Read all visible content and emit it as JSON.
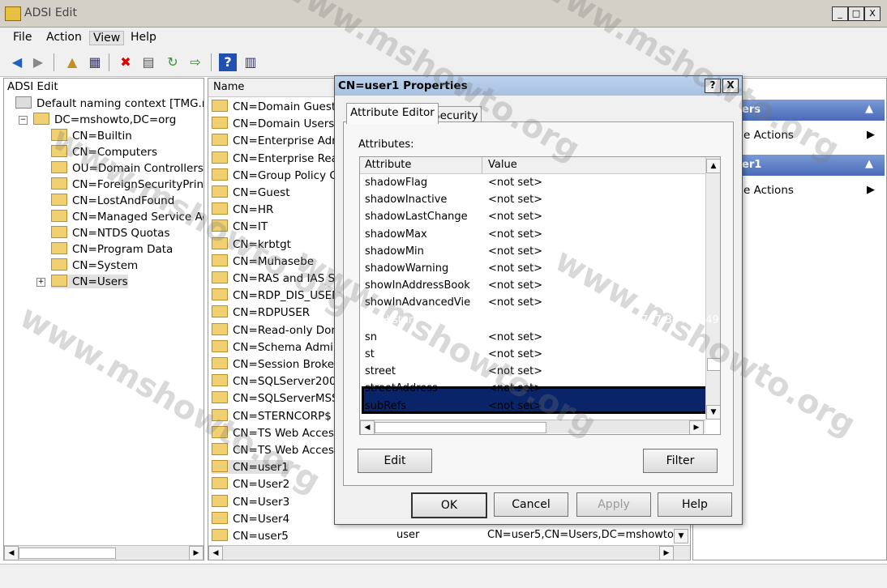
{
  "window": {
    "title": "ADSI Edit",
    "min": "_",
    "max": "□",
    "close": "X"
  },
  "menu": [
    "File",
    "Action",
    "View",
    "Help"
  ],
  "tree": {
    "root": "ADSI Edit",
    "context": "Default naming context [TMG.msh",
    "domain": "DC=mshowto,DC=org",
    "children": [
      "CN=Builtin",
      "CN=Computers",
      "OU=Domain Controllers",
      "CN=ForeignSecurityPrincip",
      "CN=LostAndFound",
      "CN=Managed Service Acco",
      "CN=NTDS Quotas",
      "CN=Program Data",
      "CN=System",
      "CN=Users"
    ]
  },
  "list": {
    "col_name": "Name",
    "rows": [
      "CN=Domain Guests",
      "CN=Domain Users",
      "CN=Enterprise Admin",
      "CN=Enterprise Read-",
      "CN=Group Policy Cre",
      "CN=Guest",
      "CN=HR",
      "CN=IT",
      "CN=krbtgt",
      "CN=Muhasebe",
      "CN=RAS and IAS Ser",
      "CN=RDP_DIS_USERS",
      "CN=RDPUSER",
      "CN=Read-only Doma",
      "CN=Schema Admins",
      "CN=Session Broker C",
      "CN=SQLServer2005S",
      "CN=SQLServerMSSQ",
      "CN=STERNCORP$",
      "CN=TS Web Access A",
      "CN=TS Web Access C",
      "CN=user1",
      "CN=User2",
      "CN=User3",
      "CN=User4",
      "CN=user5"
    ],
    "last_class": "user",
    "last_dn": "CN=user5,CN=Users,DC=mshowto,D"
  },
  "actions": {
    "section1": "ers",
    "item1": "e Actions",
    "section2": "er1",
    "item2": "e Actions"
  },
  "dialog": {
    "title": "CN=user1 Properties",
    "help": "?",
    "close": "X",
    "tabs": [
      "Attribute Editor",
      "Security"
    ],
    "attributes_label": "Attributes:",
    "col_attr": "Attribute",
    "col_value": "Value",
    "rows": [
      {
        "attr": "shadowFlag",
        "value": "<not set>"
      },
      {
        "attr": "shadowInactive",
        "value": "<not set>"
      },
      {
        "attr": "shadowLastChange",
        "value": "<not set>"
      },
      {
        "attr": "shadowMax",
        "value": "<not set>"
      },
      {
        "attr": "shadowMin",
        "value": "<not set>"
      },
      {
        "attr": "shadowWarning",
        "value": "<not set>"
      },
      {
        "attr": "showInAddressBook",
        "value": "<not set>"
      },
      {
        "attr": "showInAdvancedVie",
        "value": "<not set>"
      },
      {
        "attr": "sIDHistory",
        "value": "S-1-5-21-3479589468-138638767-38420749"
      },
      {
        "attr": "sn",
        "value": "<not set>"
      },
      {
        "attr": "st",
        "value": "<not set>"
      },
      {
        "attr": "street",
        "value": "<not set>"
      },
      {
        "attr": "streetAddress",
        "value": "<not set>"
      },
      {
        "attr": "subRefs",
        "value": "<not set>"
      }
    ],
    "edit": "Edit",
    "filter": "Filter",
    "ok": "OK",
    "cancel": "Cancel",
    "apply": "Apply",
    "help_btn": "Help"
  },
  "watermark": "www.mshowto.org"
}
